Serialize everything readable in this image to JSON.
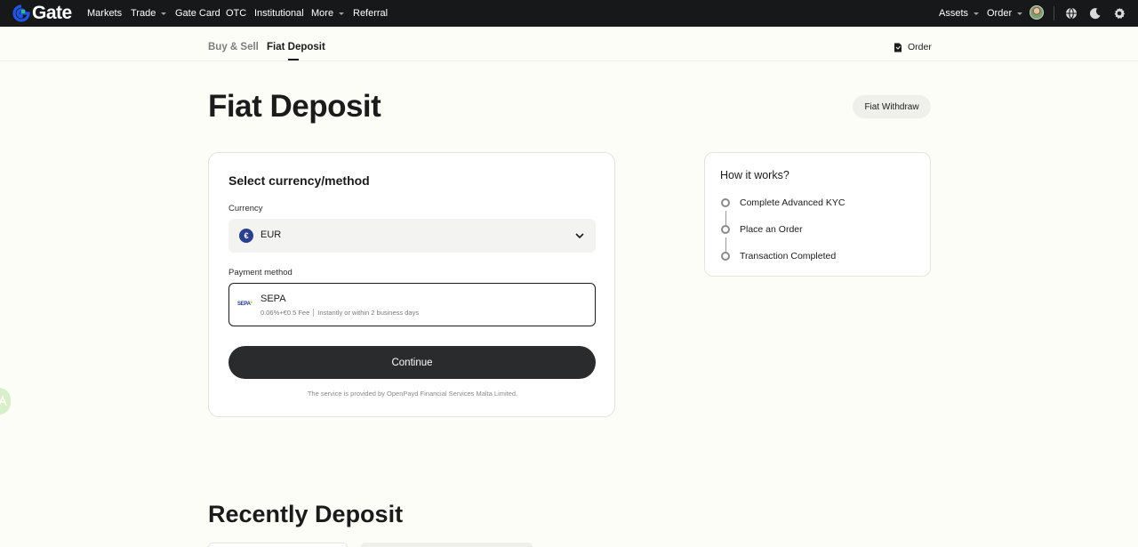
{
  "brand": {
    "name": "Gate",
    "accent": "#2354e6"
  },
  "nav": {
    "left": [
      {
        "label": "Markets",
        "dropdown": false
      },
      {
        "label": "Trade",
        "dropdown": true
      },
      {
        "label": "Gate Card",
        "dropdown": false
      },
      {
        "label": "OTC",
        "dropdown": false
      },
      {
        "label": "Institutional",
        "dropdown": false
      },
      {
        "label": "More",
        "dropdown": true
      },
      {
        "label": "Referral",
        "dropdown": false
      }
    ],
    "right": [
      {
        "label": "Assets",
        "dropdown": true
      },
      {
        "label": "Order",
        "dropdown": true
      }
    ],
    "icons": [
      "avatar",
      "globe-icon",
      "moon-icon",
      "gear-icon"
    ]
  },
  "subheader": {
    "tabs": [
      {
        "label": "Buy & Sell",
        "active": false
      },
      {
        "label": "Fiat Deposit",
        "active": true
      }
    ],
    "order_label": "Order"
  },
  "page": {
    "title": "Fiat Deposit",
    "withdraw_label": "Fiat Withdraw"
  },
  "form": {
    "title": "Select currency/method",
    "currency_label": "Currency",
    "currency_symbol": "€",
    "currency_value": "EUR",
    "payment_label": "Payment method",
    "payment": {
      "logo_text": "SEPA",
      "name": "SEPA",
      "fee": "0.06%+€0.5 Fee",
      "timing": "Instantly or within 2 business days"
    },
    "continue_label": "Continue",
    "provider_note": "The service is provided by OpenPayd Financial Services Malta Limited."
  },
  "how_it_works": {
    "title": "How it works?",
    "steps": [
      "Complete Advanced KYC",
      "Place an Order",
      "Transaction Completed"
    ]
  },
  "recent": {
    "title": "Recently Deposit"
  }
}
